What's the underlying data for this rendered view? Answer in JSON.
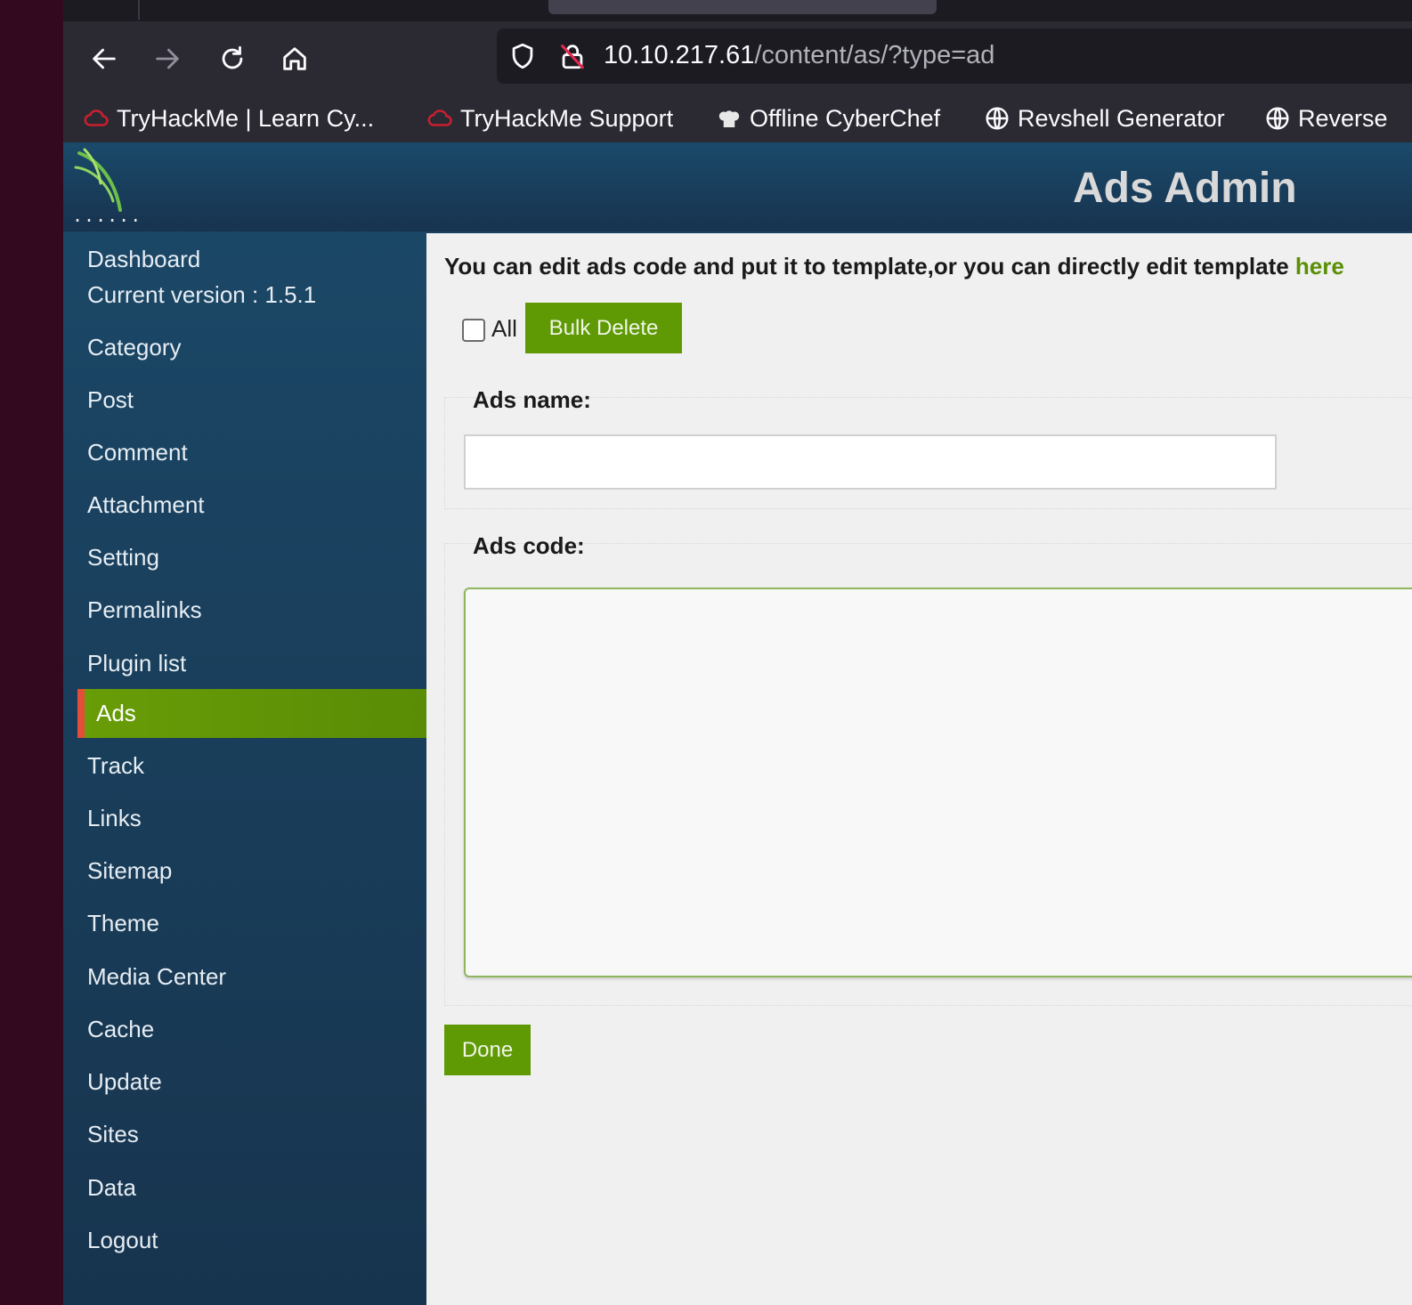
{
  "browser": {
    "url": {
      "host": "10.10.217.61",
      "path": "/content/as/?type=ad"
    },
    "bookmarks": [
      {
        "label": "TryHackMe | Learn Cy...",
        "icon": "tryhackme-cloud-icon"
      },
      {
        "label": "TryHackMe Support",
        "icon": "tryhackme-cloud-icon"
      },
      {
        "label": "Offline CyberChef",
        "icon": "chef-hat-icon"
      },
      {
        "label": "Revshell Generator",
        "icon": "globe-icon"
      },
      {
        "label": "Reverse",
        "icon": "globe-icon"
      }
    ]
  },
  "header": {
    "title": "Ads Admin",
    "logo_dots": "......"
  },
  "sidebar": {
    "dashboard": "Dashboard",
    "version": "Current version : 1.5.1",
    "items": [
      "Category",
      "Post",
      "Comment",
      "Attachment",
      "Setting",
      "Permalinks",
      "Plugin list",
      "Ads",
      "Track",
      "Links",
      "Sitemap",
      "Theme",
      "Media Center",
      "Cache",
      "Update",
      "Sites",
      "Data",
      "Logout"
    ],
    "active": "Ads"
  },
  "content": {
    "intro": "You can edit ads code and put it to template,or you can directly edit template ",
    "intro_link": "here",
    "all_label": "All",
    "bulk_delete": "Bulk Delete",
    "ads_name_label": "Ads name:",
    "ads_name_value": "",
    "ads_code_label": "Ads code:",
    "ads_code_value": "",
    "done": "Done"
  },
  "colors": {
    "accent_green": "#5f9a05",
    "sidebar_bg": "#1b4361",
    "active_marker": "#e24e3a"
  }
}
